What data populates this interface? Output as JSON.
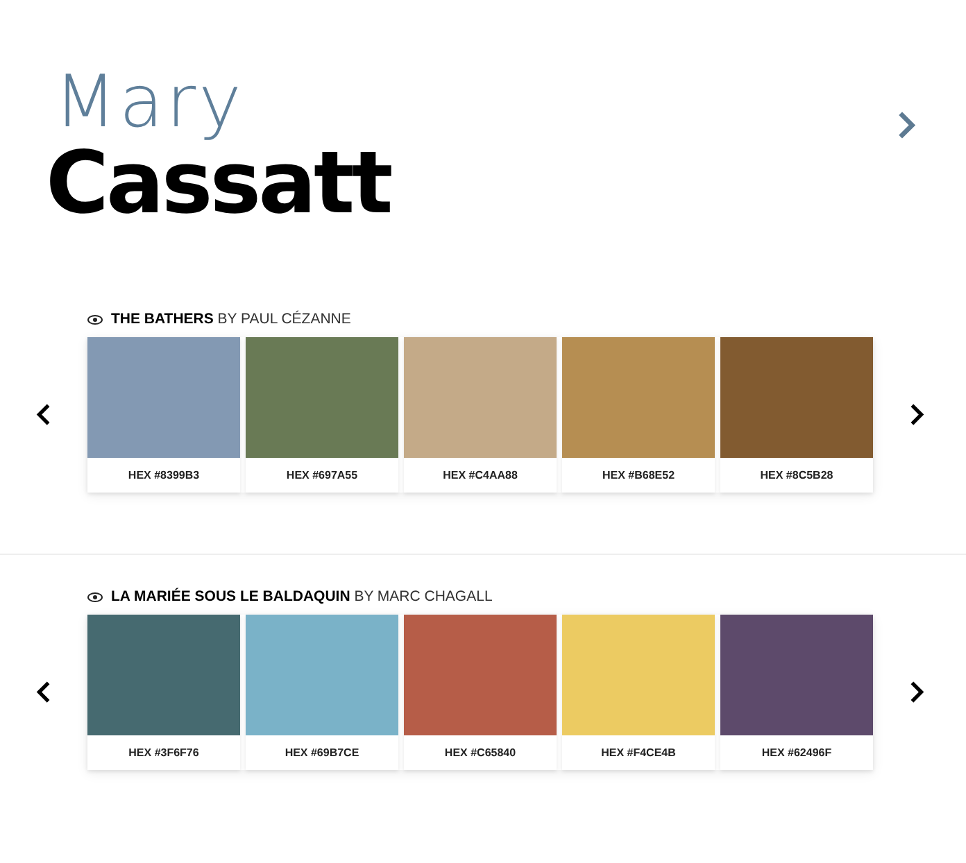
{
  "header": {
    "script_name": "Mary",
    "name": "Cassatt"
  },
  "palettes": [
    {
      "caption": "**THE BATHERS** BY PAUL CÉZANNE",
      "swatches": [
        {
          "label": "HEX #8399B3",
          "color": "#8399b3"
        },
        {
          "label": "HEX #697A55",
          "color": "#697a55"
        },
        {
          "label": "HEX #C4AA88",
          "color": "#c4aa88"
        },
        {
          "label": "HEX #B68E52",
          "color": "#b68e52"
        },
        {
          "label": "HEX #8C5B28",
          "color": "#825b30"
        }
      ]
    },
    {
      "caption": "**LA MARIÉE SOUS LE BALDAQUIN** BY MARC CHAGALL",
      "swatches": [
        {
          "label": "HEX #3F6F76",
          "color": "#466a70"
        },
        {
          "label": "HEX #69B7CE",
          "color": "#7ab2c8"
        },
        {
          "label": "HEX #C65840",
          "color": "#b65d48"
        },
        {
          "label": "HEX #F4CE4B",
          "color": "#eccb62"
        },
        {
          "label": "HEX #62496F",
          "color": "#5d4a6b"
        }
      ]
    }
  ]
}
